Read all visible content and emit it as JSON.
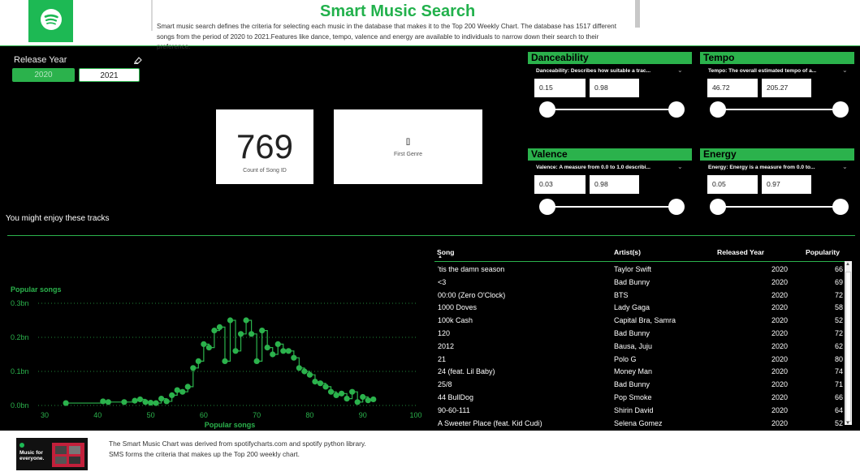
{
  "header": {
    "title": "Smart Music Search",
    "description": "Smart music search defines the criteria for selecting each music in the database that makes it to the Top 200 Weekly Chart. The database has 1517 different songs from the period of 2020 to 2021.Features like dance, tempo, valence and energy are available to individuals to narrow down their search to their preference.",
    "logo_icon": "spotify-logo-icon"
  },
  "year_filter": {
    "label": "Release Year",
    "options": [
      "2020",
      "2021"
    ],
    "selected": "2020",
    "clear_icon": "eraser-icon"
  },
  "cards": {
    "count_value": "769",
    "count_label": "Count of Song ID",
    "genre_value": "[]",
    "genre_label": "First Genre"
  },
  "filters": {
    "danceability": {
      "title": "Danceability",
      "desc": "Danceability: Describes how suitable a trac...",
      "min": "0.15",
      "max": "0.98"
    },
    "tempo": {
      "title": "Tempo",
      "desc": "Tempo: The overall estimated tempo of a...",
      "min": "46.72",
      "max": "205.27"
    },
    "valence": {
      "title": "Valence",
      "desc": "Valence: A measure from 0.0 to 1.0 describi...",
      "min": "0.03",
      "max": "0.98"
    },
    "energy": {
      "title": "Energy",
      "desc": "Energy: Energy is a measure from 0.0 to...",
      "min": "0.05",
      "max": "0.97"
    }
  },
  "tracks_label": "You might enjoy these tracks",
  "chart_data": {
    "type": "line",
    "title": "Popular songs",
    "xlabel": "Popular songs",
    "ylabel": "",
    "x_ticks": [
      "30",
      "40",
      "50",
      "60",
      "70",
      "80",
      "90",
      "100"
    ],
    "y_ticks": [
      "0.0bn",
      "0.1bn",
      "0.2bn",
      "0.3bn"
    ],
    "xlim": [
      30,
      100
    ],
    "ylim": [
      0,
      0.3
    ],
    "color": "#2bb24c",
    "series": [
      {
        "x": [
          34,
          41,
          42,
          45,
          47,
          48,
          49,
          50,
          51,
          52,
          53,
          54,
          55,
          56,
          57,
          58,
          59,
          60,
          61,
          62,
          63,
          64,
          65,
          66,
          67,
          68,
          69,
          70,
          71,
          72,
          73,
          74,
          75,
          76,
          77,
          78,
          79,
          80,
          81,
          82,
          83,
          84,
          85,
          86,
          87,
          88,
          89,
          90,
          91,
          92
        ],
        "y": [
          0.007,
          0.012,
          0.01,
          0.01,
          0.014,
          0.018,
          0.01,
          0.008,
          0.007,
          0.02,
          0.012,
          0.03,
          0.045,
          0.04,
          0.055,
          0.11,
          0.13,
          0.18,
          0.17,
          0.22,
          0.23,
          0.13,
          0.25,
          0.16,
          0.21,
          0.25,
          0.21,
          0.13,
          0.22,
          0.17,
          0.15,
          0.18,
          0.16,
          0.16,
          0.14,
          0.11,
          0.1,
          0.09,
          0.07,
          0.065,
          0.055,
          0.04,
          0.03,
          0.035,
          0.02,
          0.04,
          0.01,
          0.025,
          0.015,
          0.018
        ]
      }
    ]
  },
  "table": {
    "columns": [
      "Song",
      "Artist(s)",
      "Released Year",
      "Popularity"
    ],
    "rows": [
      [
        "'tis the damn season",
        "Taylor Swift",
        "2020",
        "66"
      ],
      [
        "<3",
        "Bad Bunny",
        "2020",
        "69"
      ],
      [
        "00:00 (Zero O'Clock)",
        "BTS",
        "2020",
        "72"
      ],
      [
        "1000 Doves",
        "Lady Gaga",
        "2020",
        "58"
      ],
      [
        "100k Cash",
        "Capital Bra, Samra",
        "2020",
        "52"
      ],
      [
        "120",
        "Bad Bunny",
        "2020",
        "72"
      ],
      [
        "2012",
        "Bausa, Juju",
        "2020",
        "62"
      ],
      [
        "21",
        "Polo G",
        "2020",
        "80"
      ],
      [
        "24 (feat. Lil Baby)",
        "Money Man",
        "2020",
        "74"
      ],
      [
        "25/8",
        "Bad Bunny",
        "2020",
        "71"
      ],
      [
        "44 BullDog",
        "Pop Smoke",
        "2020",
        "66"
      ],
      [
        "90-60-111",
        "Shirin David",
        "2020",
        "64"
      ],
      [
        "A Sweeter Place (feat. Kid Cudi)",
        "Selena Gomez",
        "2020",
        "52"
      ]
    ]
  },
  "footer": {
    "image_caption": "Music for everyone.",
    "line1": "The Smart Music Chart was derived from spotifycharts.com and spotify python library.",
    "line2": "SMS forms the criteria that makes up the Top 200 weekly chart."
  }
}
